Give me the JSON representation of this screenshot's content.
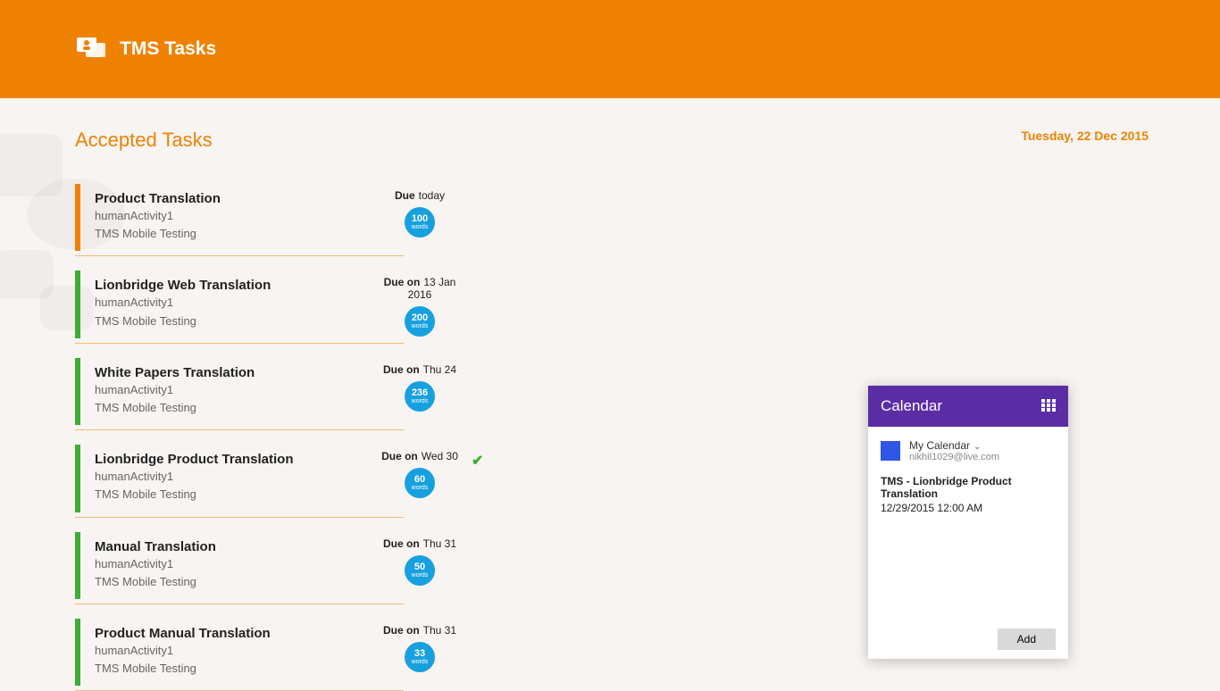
{
  "header": {
    "title": "TMS Tasks"
  },
  "section": {
    "title": "Accepted Tasks"
  },
  "today": "Tuesday, 22 Dec 2015",
  "due_label": "Due",
  "due_on_label": "Due on",
  "word_unit": "words",
  "tasks": [
    {
      "title": "Product Translation",
      "activity": "humanActivity1",
      "project": "TMS Mobile Testing",
      "due_label_variant": "today",
      "due_date": "today",
      "words": "100",
      "accent": "orange",
      "checked": false
    },
    {
      "title": "Lionbridge Web Translation",
      "activity": "humanActivity1",
      "project": "TMS Mobile Testing",
      "due_label_variant": "on",
      "due_date": "13 Jan 2016",
      "words": "200",
      "accent": "green",
      "checked": false
    },
    {
      "title": "White Papers Translation",
      "activity": "humanActivity1",
      "project": "TMS Mobile Testing",
      "due_label_variant": "on",
      "due_date": "Thu 24",
      "words": "236",
      "accent": "green",
      "checked": false
    },
    {
      "title": "Lionbridge Product Translation",
      "activity": "humanActivity1",
      "project": "TMS Mobile Testing",
      "due_label_variant": "on",
      "due_date": "Wed 30",
      "words": "60",
      "accent": "green",
      "checked": true
    },
    {
      "title": "Manual Translation",
      "activity": "humanActivity1",
      "project": "TMS Mobile Testing",
      "due_label_variant": "on",
      "due_date": "Thu 31",
      "words": "50",
      "accent": "green",
      "checked": false
    },
    {
      "title": "Product Manual Translation",
      "activity": "humanActivity1",
      "project": "TMS Mobile Testing",
      "due_label_variant": "on",
      "due_date": "Thu 31",
      "words": "33",
      "accent": "green",
      "checked": false
    }
  ],
  "calendar": {
    "title": "Calendar",
    "account_name": "My Calendar",
    "account_email": "nikhil1029@live.com",
    "event_title": "TMS - Lionbridge Product Translation",
    "event_time": "12/29/2015 12:00 AM",
    "add_label": "Add"
  }
}
